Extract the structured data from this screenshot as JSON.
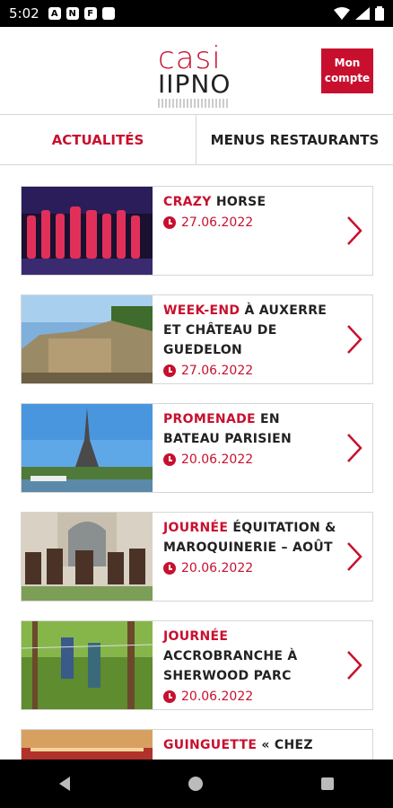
{
  "status": {
    "time": "5:02"
  },
  "header": {
    "logo_line1": "casi",
    "logo_line2": "IIPNO",
    "account_label_line1": "Mon",
    "account_label_line2": "compte"
  },
  "tabs": [
    {
      "label": "ACTUALITÉS",
      "active": true
    },
    {
      "label": "MENUS RESTAURANTS",
      "active": false
    }
  ],
  "articles": [
    {
      "accent": "CRAZY",
      "rest": " HORSE",
      "date": "27.06.2022"
    },
    {
      "accent": "WEEK-END",
      "rest": " À AUXERRE ET CHÂTEAU DE GUEDELON",
      "date": "27.06.2022"
    },
    {
      "accent": "PROMENADE",
      "rest": " EN BATEAU PARISIEN",
      "date": "20.06.2022"
    },
    {
      "accent": "JOURNÉE",
      "rest": " ÉQUITATION & MAROQUINERIE – AOÛT",
      "date": "20.06.2022"
    },
    {
      "accent": "JOURNÉE",
      "rest": " ACCROBRANCHE À SHERWOOD PARC",
      "date": "20.06.2022"
    },
    {
      "accent": "GUINGUETTE",
      "rest": " « CHEZ",
      "date": ""
    }
  ],
  "colors": {
    "accent": "#c8102e",
    "border": "#d6d6d6"
  }
}
